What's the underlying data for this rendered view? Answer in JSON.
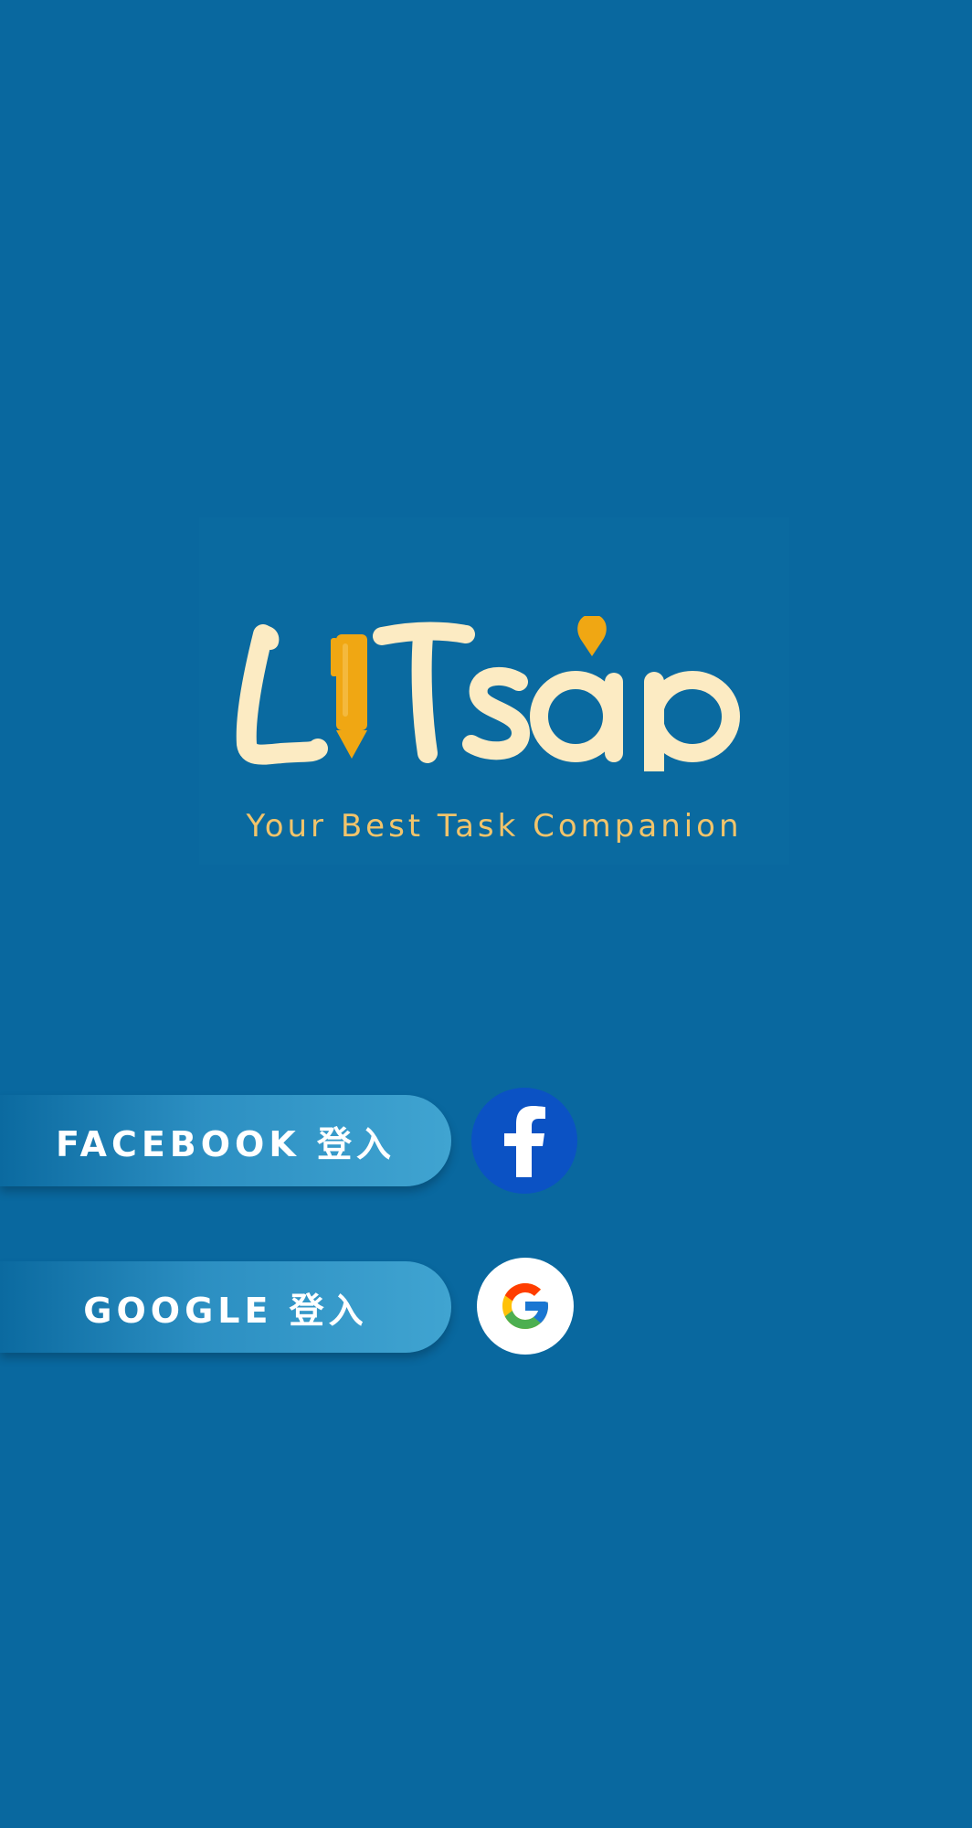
{
  "brand": {
    "logo_text": "LiTsap",
    "tagline": "Your Best Task Companion",
    "colors": {
      "background": "#09689f",
      "logo_cream": "#fcebc3",
      "logo_pencil": "#f0a713",
      "tagline": "#f1c46b"
    }
  },
  "login": {
    "facebook": {
      "label": "FACEBOOK 登入",
      "icon": "facebook-icon",
      "color": "#0b52c4"
    },
    "google": {
      "label": "GOOGLE 登入",
      "icon": "google-icon",
      "color": "#ffffff"
    }
  }
}
